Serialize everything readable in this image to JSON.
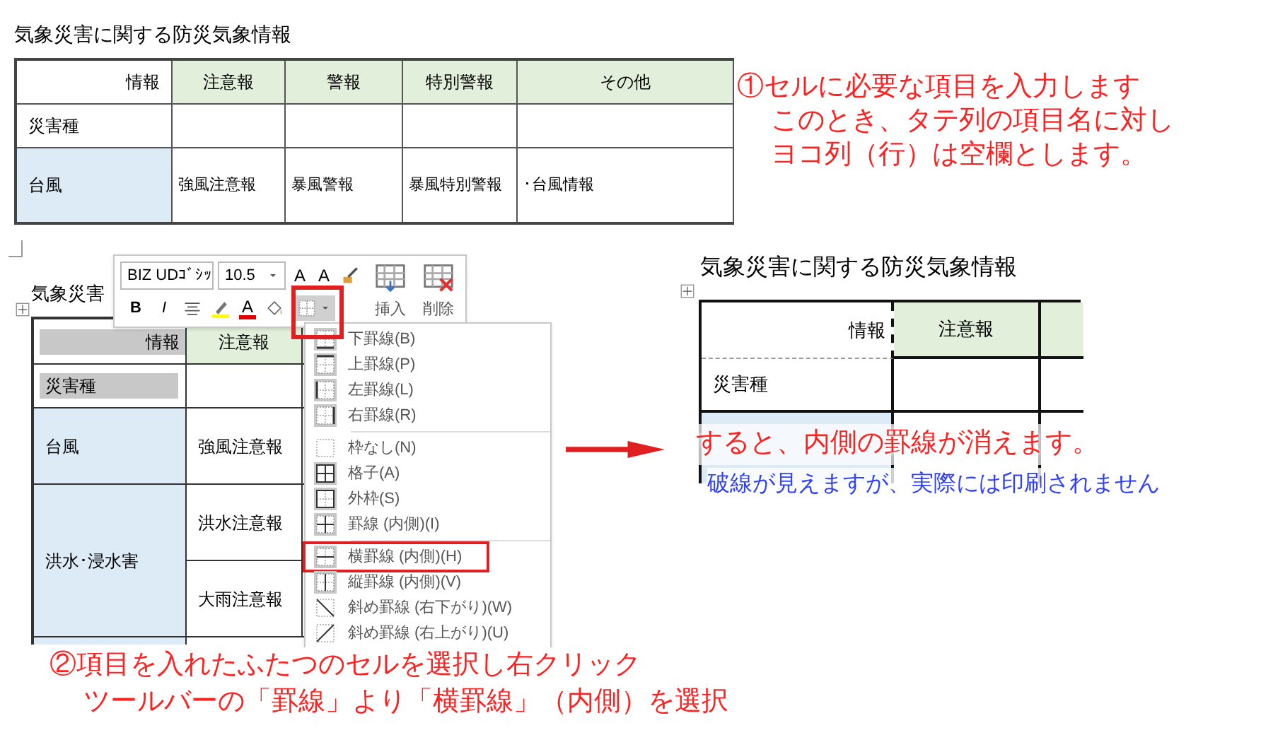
{
  "table_before": {
    "title": "気象災害に関する防災気象情報",
    "header": [
      "情報",
      "注意報",
      "警報",
      "特別警報",
      "その他"
    ],
    "rows": [
      [
        "災害種",
        "",
        "",
        "",
        ""
      ],
      [
        "台風",
        "強風注意報",
        "暴風警報",
        "暴風特別警報",
        "･台風情報"
      ]
    ]
  },
  "note_1": [
    "①セルに必要な項目を入力します",
    "このとき、タテ列の項目名に対し",
    "ヨコ列（行）は空欄とします。"
  ],
  "word_screen": {
    "title": "気象災害",
    "toolbar": {
      "row_1": [
        {
          "kind": "font",
          "value": "BIZ UDｺﾞｼｯ"
        },
        {
          "kind": "size",
          "value": "10.5"
        },
        {
          "kind": "grow",
          "label": "A"
        },
        {
          "kind": "shrink",
          "label": "A"
        },
        {
          "kind": "painter"
        }
      ],
      "row_2": [
        {
          "kind": "bold",
          "label": "B"
        },
        {
          "kind": "italic",
          "label": "I"
        },
        {
          "kind": "align"
        },
        {
          "kind": "highlight"
        },
        {
          "kind": "fontcolor",
          "label": "A"
        },
        {
          "kind": "shading"
        },
        {
          "kind": "borders"
        }
      ],
      "big": [
        {
          "kind": "insert",
          "label": "挿入"
        },
        {
          "kind": "delete",
          "label": "削除"
        }
      ]
    },
    "table": {
      "header": [
        {
          "text": "情報",
          "selected": true
        },
        {
          "text": "注意報",
          "selected": false
        }
      ],
      "rows": [
        {
          "label": "災害種",
          "selected": true,
          "cells": [
            ""
          ]
        },
        {
          "label": "台風",
          "selected": false,
          "cells": [
            "強風注意報"
          ]
        },
        {
          "label": "洪水･浸水害",
          "selected": false,
          "cells": [
            "洪水注意報",
            "大雨注意報"
          ]
        }
      ]
    },
    "menu": [
      [
        {
          "kind": "bottom",
          "label": "下罫線(B)",
          "selected": false
        },
        {
          "kind": "top",
          "label": "上罫線(P)",
          "selected": false
        },
        {
          "kind": "left",
          "label": "左罫線(L)",
          "selected": false
        },
        {
          "kind": "right",
          "label": "右罫線(R)",
          "selected": false
        }
      ],
      [
        {
          "kind": "none",
          "label": "枠なし(N)",
          "selected": false
        },
        {
          "kind": "all",
          "label": "格子(A)",
          "selected": false
        },
        {
          "kind": "outside",
          "label": "外枠(S)",
          "selected": false
        },
        {
          "kind": "inside",
          "label": "罫線 (内側)(I)",
          "selected": false
        }
      ],
      [
        {
          "kind": "inside_h",
          "label": "横罫線 (内側)(H)",
          "selected": true
        },
        {
          "kind": "inside_v",
          "label": "縦罫線 (内側)(V)",
          "selected": false
        },
        {
          "kind": "diag_down",
          "label": "斜め罫線 (右下がり)(W)",
          "selected": false
        },
        {
          "kind": "diag_up",
          "label": "斜め罫線 (右上がり)(U)",
          "selected": false
        }
      ]
    ]
  },
  "table_after": {
    "title": "気象災害に関する防災気象情報",
    "header": [
      "情報",
      "注意報"
    ],
    "row_label": "災害種"
  },
  "note_3": "すると、内側の罫線が消えます。",
  "note_4": "破線が見えますが、実際には印刷されません",
  "note_2": [
    "②項目を入れたふたつのセルを選択し右クリック",
    "ツールバーの「罫線」より「横罫線」（内側）を選択"
  ]
}
